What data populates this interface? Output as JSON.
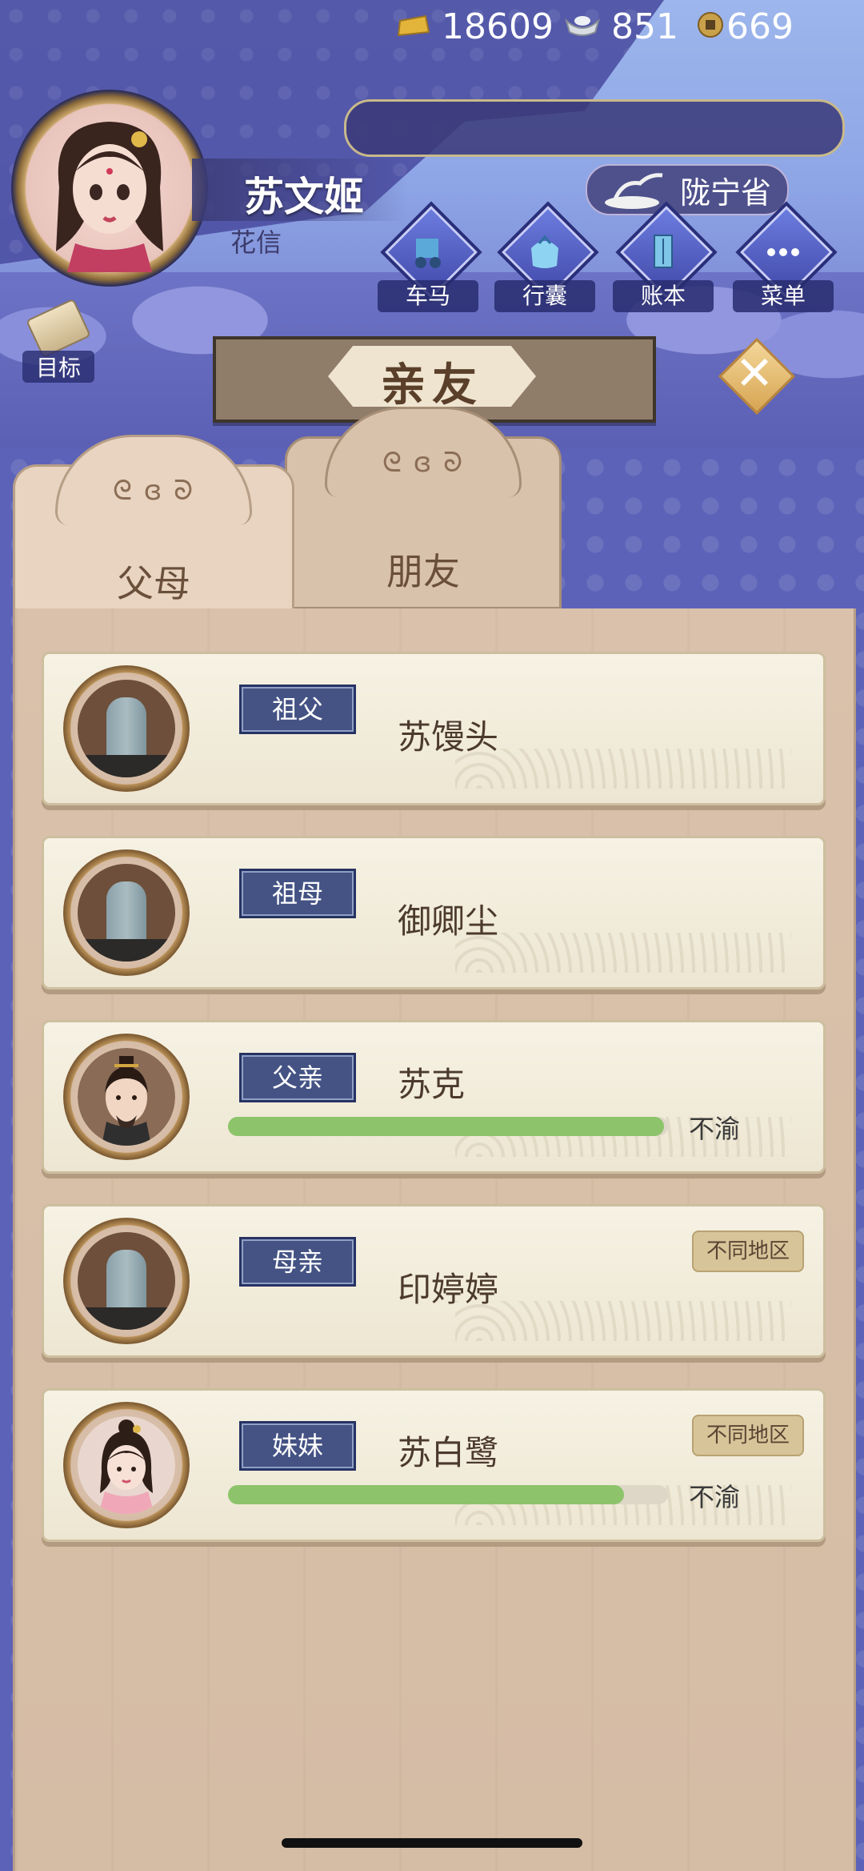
{
  "player": {
    "name": "苏文姬",
    "subtitle": "花信"
  },
  "currency": {
    "gold": "18609",
    "silver": "851",
    "coins": "669"
  },
  "region": "陇宁省",
  "menu": [
    {
      "id": "carriage",
      "label": "车马",
      "icon": "carriage-icon"
    },
    {
      "id": "bag",
      "label": "行囊",
      "icon": "bag-icon"
    },
    {
      "id": "ledger",
      "label": "账本",
      "icon": "ledger-icon"
    },
    {
      "id": "menu",
      "label": "菜单",
      "icon": "more-icon"
    }
  ],
  "target_label": "目标",
  "page_title": "亲友",
  "tabs": [
    {
      "label": "父母",
      "active": true
    },
    {
      "label": "朋友",
      "active": false
    }
  ],
  "family": [
    {
      "relation": "祖父",
      "name": "苏馒头",
      "deceased": true
    },
    {
      "relation": "祖母",
      "name": "御卿尘",
      "deceased": true
    },
    {
      "relation": "父亲",
      "name": "苏克",
      "deceased": false,
      "mood": "不渝",
      "mood_level": 0.99
    },
    {
      "relation": "母亲",
      "name": "印婷婷",
      "deceased": true,
      "region_badge": "不同地区"
    },
    {
      "relation": "妹妹",
      "name": "苏白鹭",
      "deceased": false,
      "mood": "不渝",
      "mood_level": 0.9,
      "region_badge": "不同地区"
    }
  ],
  "colors": {
    "tag_bg": "#445384",
    "mood_fill": "#8dc46b",
    "board": "#d8c0aa"
  }
}
